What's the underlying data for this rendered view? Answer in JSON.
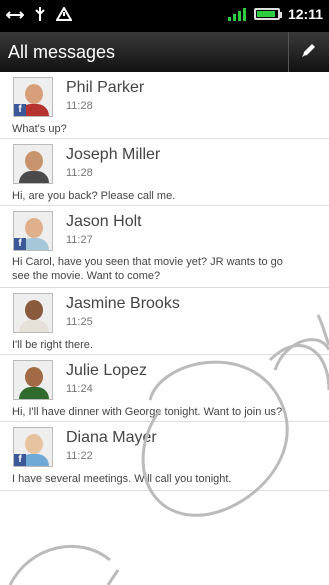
{
  "status_bar": {
    "time": "12:11",
    "icons": [
      "usb-icon",
      "debug-icon",
      "warning-icon",
      "signal-icon",
      "battery-icon"
    ]
  },
  "app_bar": {
    "title": "All messages",
    "compose_icon": "pencil-icon"
  },
  "messages": [
    {
      "name": "Phil Parker",
      "time": "11:28",
      "preview": "What's up?",
      "facebook": true
    },
    {
      "name": "Joseph Miller",
      "time": "11:28",
      "preview": "Hi, are you back? Please call me.",
      "facebook": false
    },
    {
      "name": "Jason Holt",
      "time": "11:27",
      "preview": "Hi Carol, have you seen that movie yet? JR wants to go\nsee the movie. Want to come?",
      "facebook": true
    },
    {
      "name": "Jasmine Brooks",
      "time": "11:25",
      "preview": "I'll be right there.",
      "facebook": false
    },
    {
      "name": "Julie Lopez",
      "time": "11:24",
      "preview": "Hi, I'll have dinner with George tonight. Want to join us?",
      "facebook": false
    },
    {
      "name": "Diana Mayer",
      "time": "11:22",
      "preview": "I have several meetings. Will call you tonight.",
      "facebook": true
    }
  ],
  "colors": {
    "facebook": "#3b5998",
    "signal": "#2ecc40"
  }
}
